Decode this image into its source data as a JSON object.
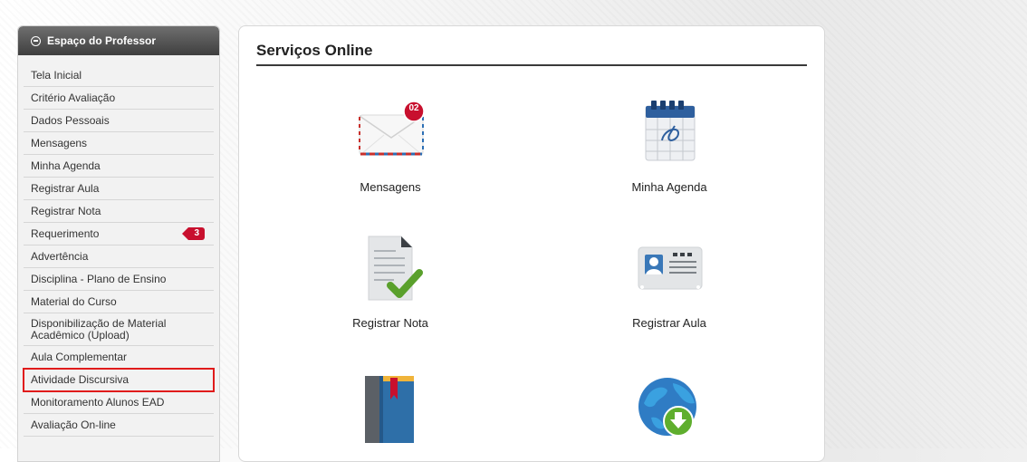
{
  "sidebar": {
    "title": "Espaço do Professor",
    "items": [
      {
        "label": "Tela Inicial"
      },
      {
        "label": "Critério Avaliação"
      },
      {
        "label": "Dados Pessoais"
      },
      {
        "label": "Mensagens"
      },
      {
        "label": "Minha Agenda"
      },
      {
        "label": "Registrar Aula"
      },
      {
        "label": "Registrar Nota"
      },
      {
        "label": "Requerimento",
        "badge": "3"
      },
      {
        "label": "Advertência"
      },
      {
        "label": "Disciplina - Plano de Ensino"
      },
      {
        "label": "Material do Curso"
      },
      {
        "label": "Disponibilização de Material Acadêmico (Upload)"
      },
      {
        "label": "Aula Complementar"
      },
      {
        "label": "Atividade Discursiva"
      },
      {
        "label": "Monitoramento Alunos EAD"
      },
      {
        "label": "Avaliação On-line"
      }
    ]
  },
  "main": {
    "title": "Serviços Online",
    "services": [
      {
        "label": "Mensagens",
        "icon": "envelope-icon",
        "badge": "02"
      },
      {
        "label": "Minha Agenda",
        "icon": "calendar-icon"
      },
      {
        "label": "Registrar Nota",
        "icon": "document-check-icon"
      },
      {
        "label": "Registrar Aula",
        "icon": "id-card-icon"
      },
      {
        "label": "",
        "icon": "book-icon"
      },
      {
        "label": "",
        "icon": "globe-download-icon"
      }
    ]
  },
  "colors": {
    "header_bg": "#4a4a4a",
    "badge_red": "#c8102e",
    "highlight_red": "#e01b1b"
  }
}
